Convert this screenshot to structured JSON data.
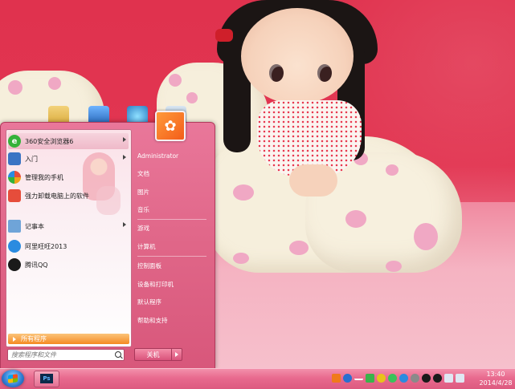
{
  "start_menu": {
    "programs": [
      {
        "label": "360安全浏览器6",
        "icon": "browser-360-icon",
        "color": "#35b23a",
        "has_submenu": true
      },
      {
        "label": "入门",
        "icon": "getting-started-icon",
        "color": "#3a74c4",
        "has_submenu": true
      },
      {
        "label": "管理我的手机",
        "icon": "phone-manager-icon",
        "color": "#f0a21a",
        "has_submenu": false
      },
      {
        "label": "强力卸载电脑上的软件",
        "icon": "uninstaller-icon",
        "color": "#e64d3b",
        "has_submenu": false
      },
      {
        "label": "记事本",
        "icon": "notepad-icon",
        "color": "#6fa4d8",
        "has_submenu": true
      },
      {
        "label": "阿里旺旺2013",
        "icon": "aliwangwang-icon",
        "color": "#2a8be0",
        "has_submenu": false
      },
      {
        "label": "腾讯QQ",
        "icon": "qq-penguin-icon",
        "color": "#1a1a1a",
        "has_submenu": false
      }
    ],
    "all_programs": "所有程序",
    "search_placeholder": "搜索程序和文件",
    "right_items": [
      "Administrator",
      "文档",
      "图片",
      "音乐",
      "游戏",
      "计算机",
      "控制面板",
      "设备和打印机",
      "默认程序",
      "帮助和支持"
    ],
    "shutdown_label": "关机"
  },
  "taskbar": {
    "pinned": [
      {
        "label": "Ps",
        "icon": "photoshop-icon"
      }
    ],
    "clock_time": "13:40",
    "clock_date": "2014/4/28"
  },
  "colors": {
    "accent": "#e06688",
    "taskbar": "#e86a8e",
    "all_programs_bar": "#f58a22"
  }
}
